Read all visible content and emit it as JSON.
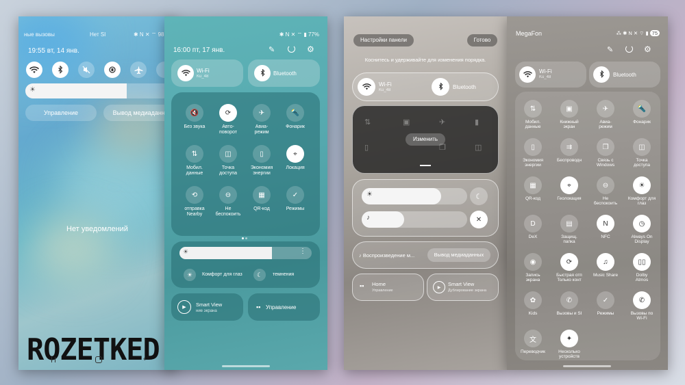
{
  "phone1": {
    "status_left": "ные вызовы",
    "status_mid": "Нет SI",
    "status_right": "98",
    "time_date": "19:55  вт, 14 янв.",
    "manage_button": "Управление",
    "media_button": "Вывод медиаданны",
    "no_notifications": "Нет уведомлений",
    "brightness_level": 0.7
  },
  "phone2": {
    "status_right": "77%",
    "time_date": "16:00  пт, 17 янв.",
    "wifi": {
      "label": "Wi-Fi",
      "sub": "Ku_48"
    },
    "bluetooth": {
      "label": "Bluetooth"
    },
    "grid": [
      {
        "label": "Без звука",
        "icon": "mute-icon",
        "on": false
      },
      {
        "label": "Авто-\nповорот",
        "icon": "rotate-icon",
        "on": true
      },
      {
        "label": "Авиа-\nрежим",
        "icon": "airplane-icon",
        "on": false
      },
      {
        "label": "Фонарик",
        "icon": "flashlight-icon",
        "on": false
      },
      {
        "label": "Мобил.\nданные",
        "icon": "mobile-data-icon",
        "on": false
      },
      {
        "label": "Точка\nдоступа",
        "icon": "hotspot-icon",
        "on": false
      },
      {
        "label": "Экономия\nэнергии",
        "icon": "battery-icon",
        "on": false
      },
      {
        "label": "Локация",
        "icon": "location-icon",
        "on": true
      },
      {
        "label": "отправка\nNearby",
        "icon": "share-icon",
        "on": false
      },
      {
        "label": "Не\nбеспокоить",
        "icon": "dnd-icon",
        "on": false
      },
      {
        "label": "QR-код",
        "icon": "qr-icon",
        "on": false
      },
      {
        "label": "Режимы",
        "icon": "modes-icon",
        "on": false
      }
    ],
    "eye_comfort": "Комфорт для глаз",
    "dark_mode": "темнения",
    "smart_view": {
      "label": "Smart View",
      "sub": "ние экрана"
    },
    "manage": "Управление"
  },
  "phone3": {
    "panel_settings": "Настройки панели",
    "done": "Готово",
    "hint": "Коснитесь и удерживайте для изменения порядка.",
    "wifi": {
      "label": "Wi-Fi",
      "sub": "Ku_48"
    },
    "bluetooth": {
      "label": "Bluetooth"
    },
    "edit": "Изменить",
    "media_play": "Воспроизведение м...",
    "media_output": "Вывод медиаданных",
    "home": {
      "label": "Home",
      "sub": "Управление"
    },
    "smart_view": {
      "label": "Smart View",
      "sub": "Дублирование экрана"
    }
  },
  "phone4": {
    "carrier": "MegaFon",
    "battery": "75",
    "wifi": {
      "label": "Wi-Fi",
      "sub": "Ku_48"
    },
    "bluetooth": {
      "label": "Bluetooth"
    },
    "grid": [
      {
        "label": "Мобил.\nданные",
        "icon": "mobile-data-icon",
        "on": false
      },
      {
        "label": "Книжный\nэкран",
        "icon": "portrait-icon",
        "on": false
      },
      {
        "label": "Авиа-\nрежим",
        "icon": "airplane-icon",
        "on": false
      },
      {
        "label": "Фонарик",
        "icon": "flashlight-icon",
        "on": false
      },
      {
        "label": "Экономия\nэнергии",
        "icon": "battery-icon",
        "on": false
      },
      {
        "label": "Беспроводн",
        "icon": "wireless-share-icon",
        "on": false
      },
      {
        "label": "Связь с\nWindows",
        "icon": "windows-link-icon",
        "on": false
      },
      {
        "label": "Точка\nдоступа",
        "icon": "hotspot-icon",
        "on": false
      },
      {
        "label": "QR-код",
        "icon": "qr-icon",
        "on": false
      },
      {
        "label": "Геолокация",
        "icon": "location-icon",
        "on": true
      },
      {
        "label": "Не\nбеспокоить",
        "icon": "dnd-icon",
        "on": false
      },
      {
        "label": "Комфорт для\nглаз",
        "icon": "sun-icon",
        "on": true
      },
      {
        "label": "DeX",
        "icon": "dex-icon",
        "on": false
      },
      {
        "label": "Защищ.\nпапка",
        "icon": "secure-folder-icon",
        "on": false
      },
      {
        "label": "NFC",
        "icon": "nfc-icon",
        "on": true
      },
      {
        "label": "Always On\nDisplay",
        "icon": "clock-icon",
        "on": true
      },
      {
        "label": "Запись\nэкрана",
        "icon": "screen-record-icon",
        "on": false
      },
      {
        "label": "Быстрая отп\nТолько конт",
        "icon": "quick-share-icon",
        "on": true
      },
      {
        "label": "Music Share",
        "icon": "music-share-icon",
        "on": true
      },
      {
        "label": "Dolby\nAtmos",
        "icon": "dolby-icon",
        "on": true
      },
      {
        "label": "Kids",
        "icon": "kids-icon",
        "on": false
      },
      {
        "label": "Вызовы и SI",
        "icon": "calls-icon",
        "on": false
      },
      {
        "label": "Режимы",
        "icon": "modes-icon",
        "on": false
      },
      {
        "label": "Вызовы по\nWi-Fi",
        "icon": "wifi-call-icon",
        "on": true
      },
      {
        "label": "Переводчик",
        "icon": "translate-icon",
        "on": false
      },
      {
        "label": "Несколько\nустройств",
        "icon": "multi-device-icon",
        "on": true
      }
    ]
  },
  "logo": "ROZETKED"
}
